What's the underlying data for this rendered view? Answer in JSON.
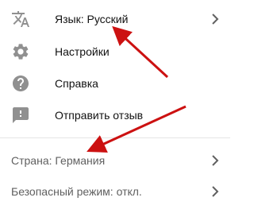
{
  "menu": {
    "items": [
      {
        "label": "Язык: Русский",
        "icon": "translate-icon",
        "chevron": true
      },
      {
        "label": "Настройки",
        "icon": "gear-icon",
        "chevron": false
      },
      {
        "label": "Справка",
        "icon": "help-icon",
        "chevron": false
      },
      {
        "label": "Отправить отзыв",
        "icon": "feedback-icon",
        "chevron": false
      }
    ],
    "secondary": [
      {
        "label": "Страна: Германия",
        "chevron": true
      },
      {
        "label": "Безопасный режим: откл.",
        "chevron": true
      }
    ]
  },
  "colors": {
    "icon": "#909090",
    "text": "#111111",
    "secondary_text": "#606060",
    "annotation_arrow": "#cc1111"
  }
}
